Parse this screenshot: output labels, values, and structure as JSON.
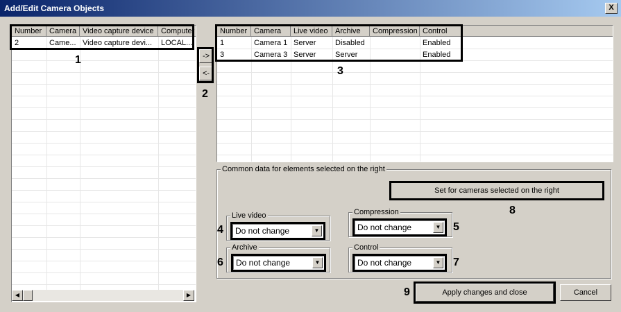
{
  "window": {
    "title": "Add/Edit Camera Objects",
    "close_glyph": "X"
  },
  "left_grid": {
    "columns": [
      "Number",
      "Camera",
      "Video capture device",
      "Computer"
    ],
    "rows": [
      [
        "2",
        "Came...",
        "Video capture devi...",
        "LOCAL..."
      ]
    ]
  },
  "right_grid": {
    "columns": [
      "Number",
      "Camera",
      "Live video",
      "Archive",
      "Compression",
      "Control"
    ],
    "rows": [
      [
        "1",
        "Camera 1",
        "Server",
        "Disabled",
        "",
        "Enabled"
      ],
      [
        "3",
        "Camera 3",
        "Server",
        "Server",
        "",
        "Enabled"
      ]
    ]
  },
  "move_buttons": {
    "add": "->",
    "remove": "<-"
  },
  "common_group": {
    "label": "Common data for elements selected on the right",
    "set_button": "Set for cameras selected on the right"
  },
  "fields": {
    "live_video": {
      "label": "Live video",
      "value": "Do not change"
    },
    "archive": {
      "label": "Archive",
      "value": "Do not change"
    },
    "compression": {
      "label": "Compression",
      "value": "Do not change"
    },
    "control": {
      "label": "Control",
      "value": "Do not change"
    }
  },
  "buttons": {
    "apply": "Apply changes and close",
    "cancel": "Cancel"
  },
  "callouts": [
    "1",
    "2",
    "3",
    "4",
    "5",
    "6",
    "7",
    "8",
    "9"
  ]
}
